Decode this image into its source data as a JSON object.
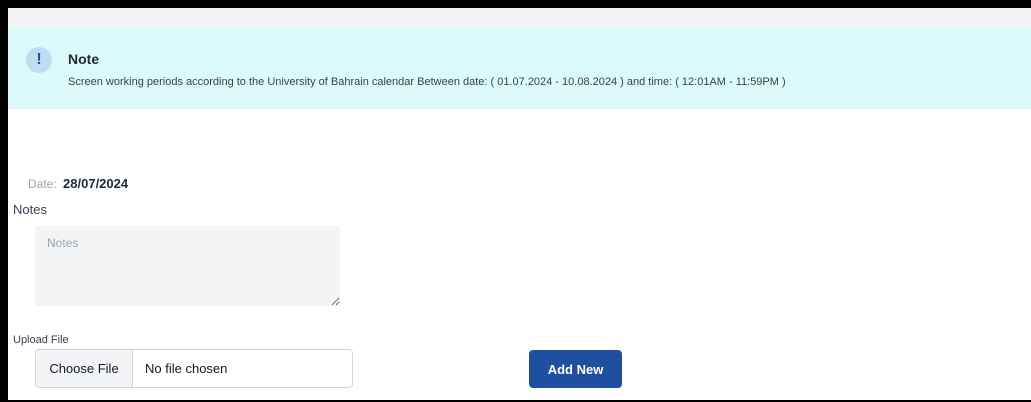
{
  "note": {
    "icon": "exclamation-icon",
    "icon_glyph": "!",
    "title": "Note",
    "text": "Screen working periods according to the University of Bahrain calendar Between date: ( 01.07.2024 - 10.08.2024 ) and time: ( 12:01AM - 11:59PM )"
  },
  "form": {
    "date_label": "Date:",
    "date_value": "28/07/2024",
    "notes_label": "Notes",
    "notes_placeholder": "Notes",
    "notes_value": "",
    "upload_label": "Upload File",
    "choose_file_label": "Choose File",
    "no_file_text": "No file chosen",
    "add_new_label": "Add New"
  },
  "colors": {
    "banner_bg": "#ddfafb",
    "primary_button": "#1e4fa1",
    "icon_bg": "#bfdcf2"
  }
}
